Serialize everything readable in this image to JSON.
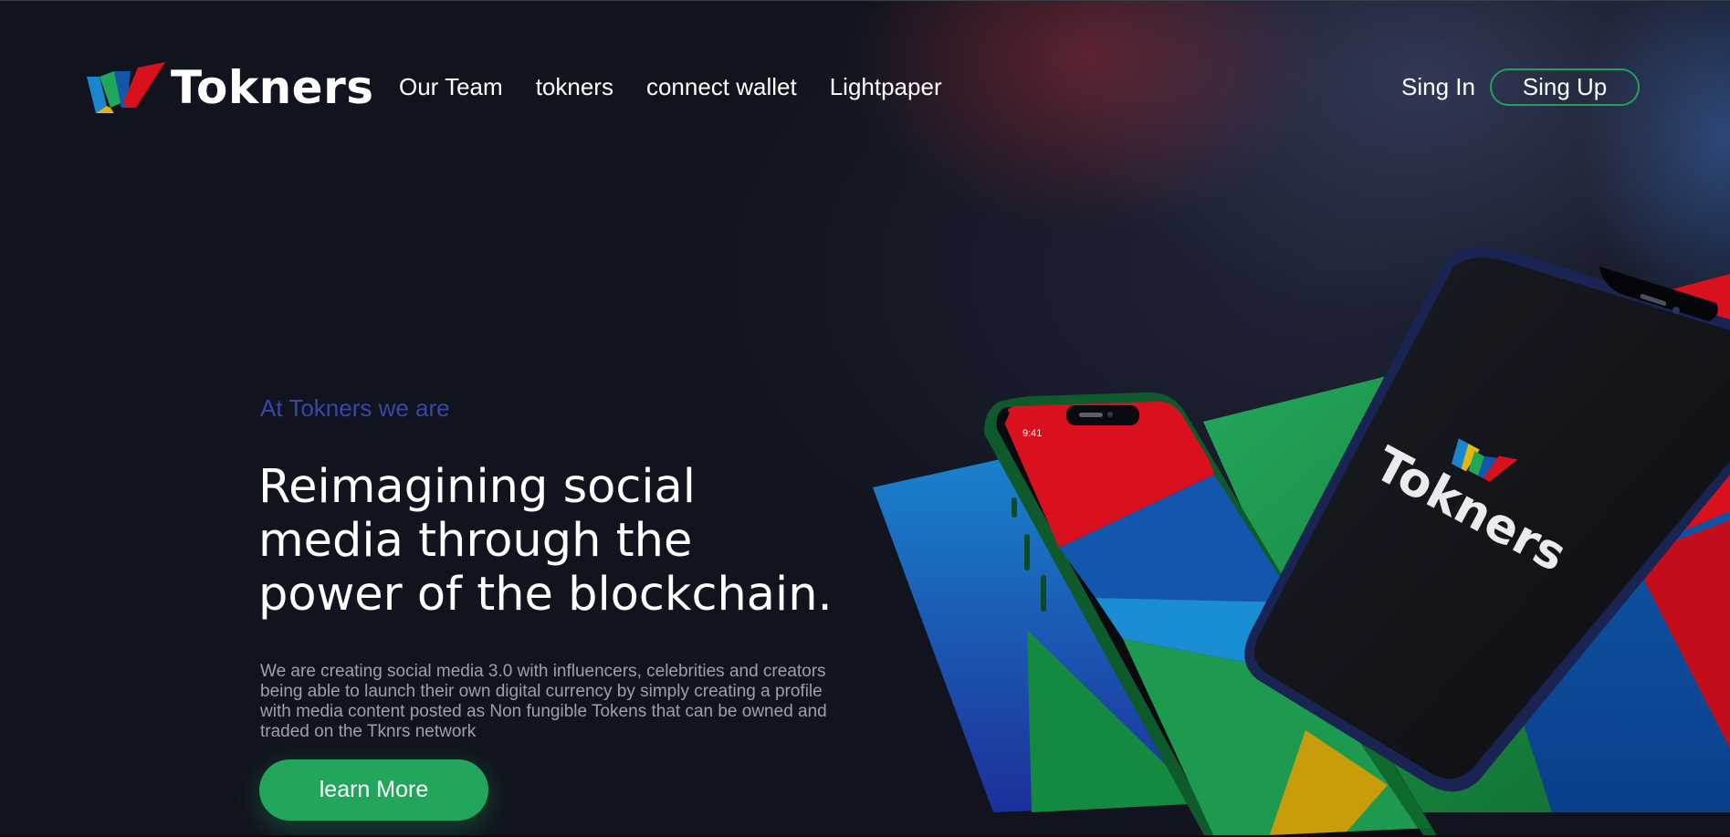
{
  "brand": {
    "name": "Tokners",
    "colors": {
      "background": "#11141e",
      "accent_green": "#21a65c",
      "eyebrow_blue": "#3a45a8",
      "red": "#d9101e",
      "blue": "#1769b6",
      "yellow": "#e0b810"
    }
  },
  "nav": {
    "items": [
      {
        "label": "Our Team"
      },
      {
        "label": "tokners"
      },
      {
        "label": "connect wallet"
      },
      {
        "label": "Lightpaper"
      }
    ]
  },
  "auth": {
    "sign_in": "Sing In",
    "sign_up": "Sing Up"
  },
  "hero": {
    "eyebrow": "At Tokners we are",
    "headline": "Reimagining social media through the power of the blockchain.",
    "description": "We are creating social media 3.0 with influencers, celebrities and creators being able to launch their own digital currency by simply creating a profile with media content posted as Non fungible Tokens that can be owned and traded on the Tknrs network",
    "cta": "learn More"
  },
  "phones": {
    "front_time": "9:41",
    "back_logo_text": "Tokners"
  },
  "icons": [
    "tokners-logo-mark",
    "phone-mockup-icon"
  ]
}
